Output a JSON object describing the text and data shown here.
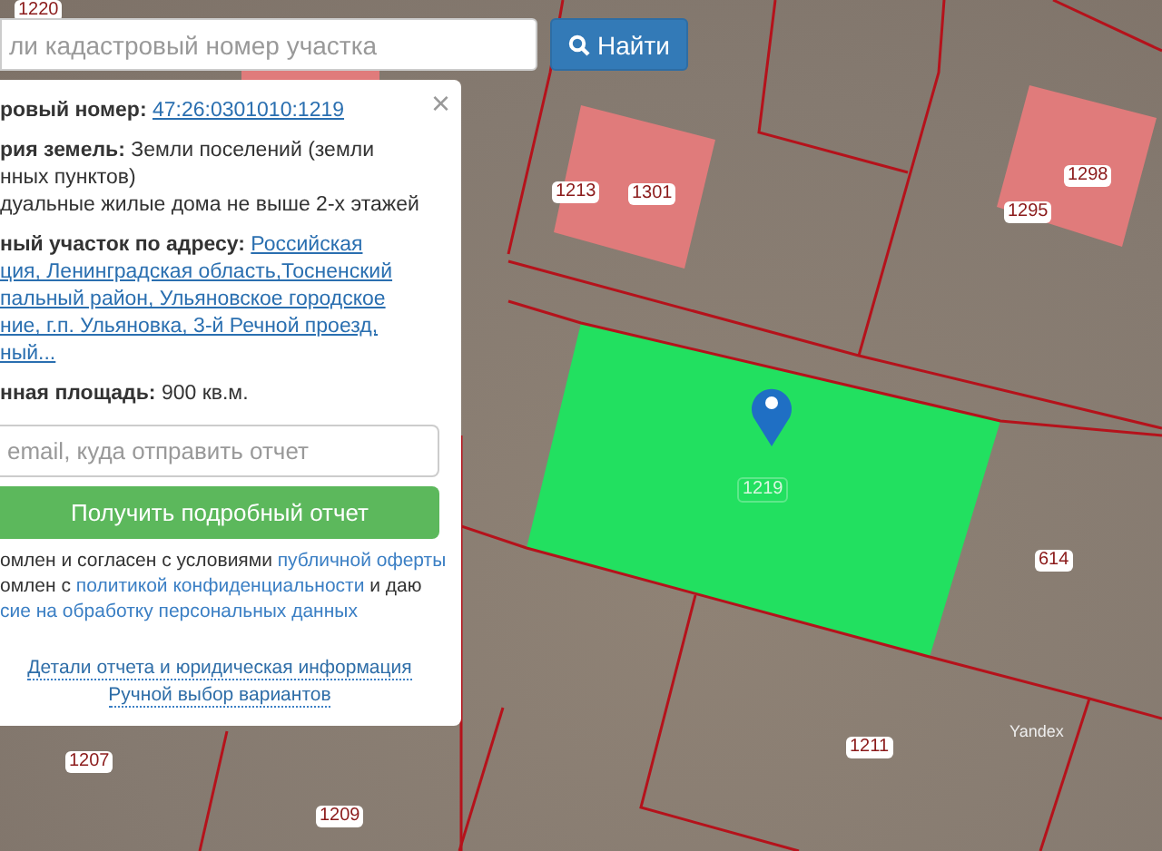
{
  "search": {
    "placeholder": "ли кадастровый номер участка",
    "button": "Найти"
  },
  "info_panel": {
    "close": "×",
    "cadastral": {
      "label": "ровый номер:",
      "value": "47:26:0301010:1219"
    },
    "category": {
      "label": "рия земель:",
      "value_lines": [
        "Земли поселений (земли",
        "нных пунктов)"
      ]
    },
    "permitted_use": "дуальные жилые дома не выше 2-х этажей",
    "address": {
      "label": "ный участок по адресу:",
      "lines": [
        "Российская",
        "ция, Ленинградская область,Тосненский",
        "пальный район, Ульяновское городское",
        "ние, г.п. Ульяновка, 3-й Речной проезд,",
        "ный..."
      ]
    },
    "area": {
      "label": "нная площадь:",
      "value": "900 кв.м."
    },
    "email": {
      "placeholder": "email, куда отправить отчет"
    },
    "submit": "Получить подробный отчет",
    "consent": [
      {
        "text": "омлен и согласен с условиями ",
        "link": "публичной оферты"
      },
      {
        "text": "омлен с ",
        "link": "политикой конфиденциальности",
        "after": " и даю"
      },
      {
        "link": "сие на обработку персональных данных"
      }
    ],
    "links": [
      "Детали отчета и юридическая информация",
      "Ручной выбор вариантов"
    ]
  },
  "map": {
    "parcel_labels": [
      {
        "text": "1220",
        "selected": false
      },
      {
        "text": "1213",
        "selected": false
      },
      {
        "text": "1301",
        "selected": false
      },
      {
        "text": "1298",
        "selected": false
      },
      {
        "text": "1295",
        "selected": false
      },
      {
        "text": "1219",
        "selected": true
      },
      {
        "text": "614",
        "selected": false
      },
      {
        "text": "1211",
        "selected": false
      },
      {
        "text": "1207",
        "selected": false
      },
      {
        "text": "1209",
        "selected": false
      }
    ],
    "attribution": "Yandex"
  }
}
